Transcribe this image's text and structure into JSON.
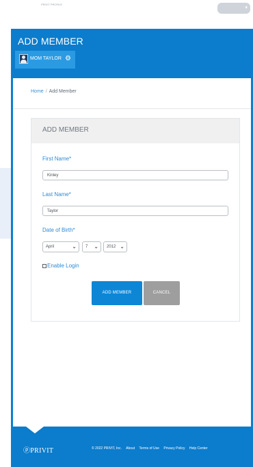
{
  "top_bar": {
    "logo_text": "PRIVIT PROFILE",
    "user_menu_caret": "▾"
  },
  "header": {
    "title": "ADD MEMBER",
    "member_name": "MOM TAYLOR",
    "gear_icon": "⚙"
  },
  "breadcrumb": {
    "home": "Home",
    "separator": "/",
    "current": "Add Member"
  },
  "card": {
    "title": "ADD MEMBER",
    "first_name": {
      "label": "First Name*",
      "value": "Kinley"
    },
    "last_name": {
      "label": "Last Name*",
      "value": "Taylor"
    },
    "dob": {
      "label": "Date of Birth*",
      "month": "April",
      "day": "7",
      "year": "2012",
      "chevron": "⌄"
    },
    "enable_login_label": "Enable Login",
    "add_button": "ADD MEMBER",
    "cancel_button": "CANCEL"
  },
  "footer": {
    "logo": "ⓟPRIVIT",
    "copyright": "© 2022 PRIVIT, Inc.",
    "links": [
      "About",
      "Terms of Use",
      "Privacy Policy",
      "Help Center"
    ]
  },
  "colors": {
    "brand_blue": "#0c7ccc",
    "tab_blue": "#2a9be3",
    "label_blue": "#2e8ad4",
    "button_blue": "#0d86d6",
    "cancel_gray": "#9e9e9e"
  }
}
